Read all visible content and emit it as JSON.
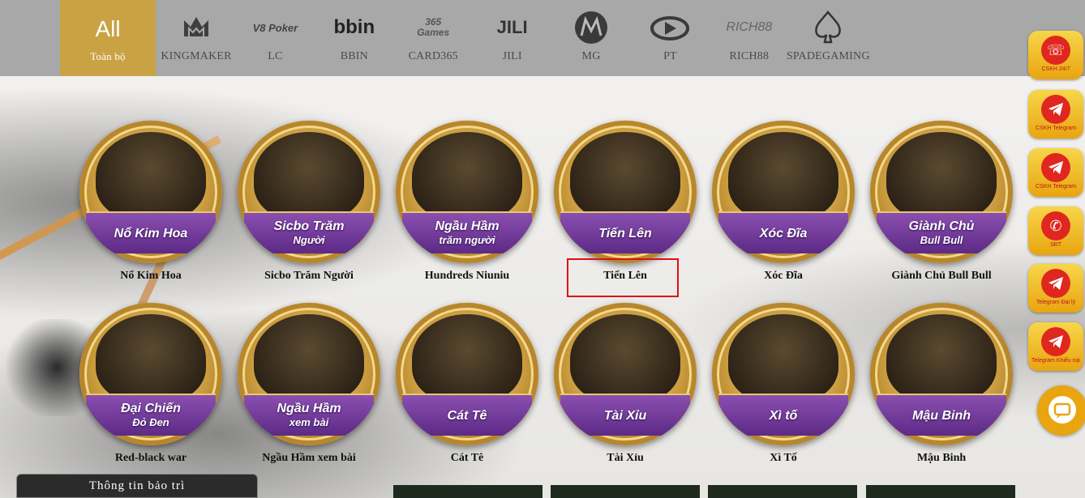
{
  "providers": [
    {
      "logo": "All",
      "label": "Toàn bộ",
      "active": true,
      "icon": "all"
    },
    {
      "logo": "",
      "label": "KINGMAKER",
      "icon": "kingmaker-crown-icon"
    },
    {
      "logo": "V8 Poker",
      "label": "LC",
      "icon": "v8-poker-logo"
    },
    {
      "logo": "bbin",
      "label": "BBIN",
      "icon": "bbin-logo"
    },
    {
      "logo": "365 Games",
      "label": "CARD365",
      "icon": "card365-logo"
    },
    {
      "logo": "JILI",
      "label": "JILI",
      "icon": "jili-logo"
    },
    {
      "logo": "",
      "label": "MG",
      "icon": "mg-logo"
    },
    {
      "logo": "",
      "label": "PT",
      "icon": "pt-logo"
    },
    {
      "logo": "RICH88",
      "label": "RICH88",
      "icon": "rich88-logo"
    },
    {
      "logo": "",
      "label": "SPADEGAMING",
      "icon": "spade-icon"
    }
  ],
  "games": [
    {
      "banner": "Nổ Kim Hoa",
      "banner_sub": "",
      "title": "Nổ Kim Hoa"
    },
    {
      "banner": "Sicbo Trăm",
      "banner_sub": "Người",
      "title": "Sicbo Trăm Người"
    },
    {
      "banner": "Ngầu Hầm",
      "banner_sub": "trăm người",
      "title": "Hundreds Niuniu"
    },
    {
      "banner": "Tiến Lên",
      "banner_sub": "",
      "title": "Tiến Lên"
    },
    {
      "banner": "Xóc Đĩa",
      "banner_sub": "",
      "title": "Xóc Đĩa"
    },
    {
      "banner": "Giành Chủ",
      "banner_sub": "Bull Bull",
      "title": "Giành Chủ Bull Bull"
    },
    {
      "banner": "Đại Chiến",
      "banner_sub": "Đỏ Đen",
      "title": "Red-black war"
    },
    {
      "banner": "Ngầu Hầm",
      "banner_sub": "xem bài",
      "title": "Ngầu Hầm xem bài"
    },
    {
      "banner": "Cát Tê",
      "banner_sub": "",
      "title": "Cát Tê"
    },
    {
      "banner": "Tài Xỉu",
      "banner_sub": "",
      "title": "Tài Xỉu"
    },
    {
      "banner": "Xì tố",
      "banner_sub": "",
      "title": "Xì Tố"
    },
    {
      "banner": "Mậu Binh",
      "banner_sub": "",
      "title": "Mậu Binh"
    }
  ],
  "maintenance": "Thông tin bảo trì",
  "side_buttons": [
    {
      "label": "CSKH 24/7",
      "icon": "headset-icon"
    },
    {
      "label": "CSKH Telegram",
      "icon": "telegram-icon"
    },
    {
      "label": "CSKH Telegram",
      "icon": "telegram-icon"
    },
    {
      "label": "SĐT",
      "icon": "phone-icon"
    },
    {
      "label": "Telegram Đại lý",
      "icon": "telegram-icon"
    },
    {
      "label": "Telegram Khiếu nại",
      "icon": "telegram-icon"
    }
  ],
  "colors": {
    "active_tab": "#c9a243",
    "topbar": "#a8a8a8",
    "banner": "#6a3595",
    "highlight": "#dd1111",
    "side": "#f2c12e"
  }
}
